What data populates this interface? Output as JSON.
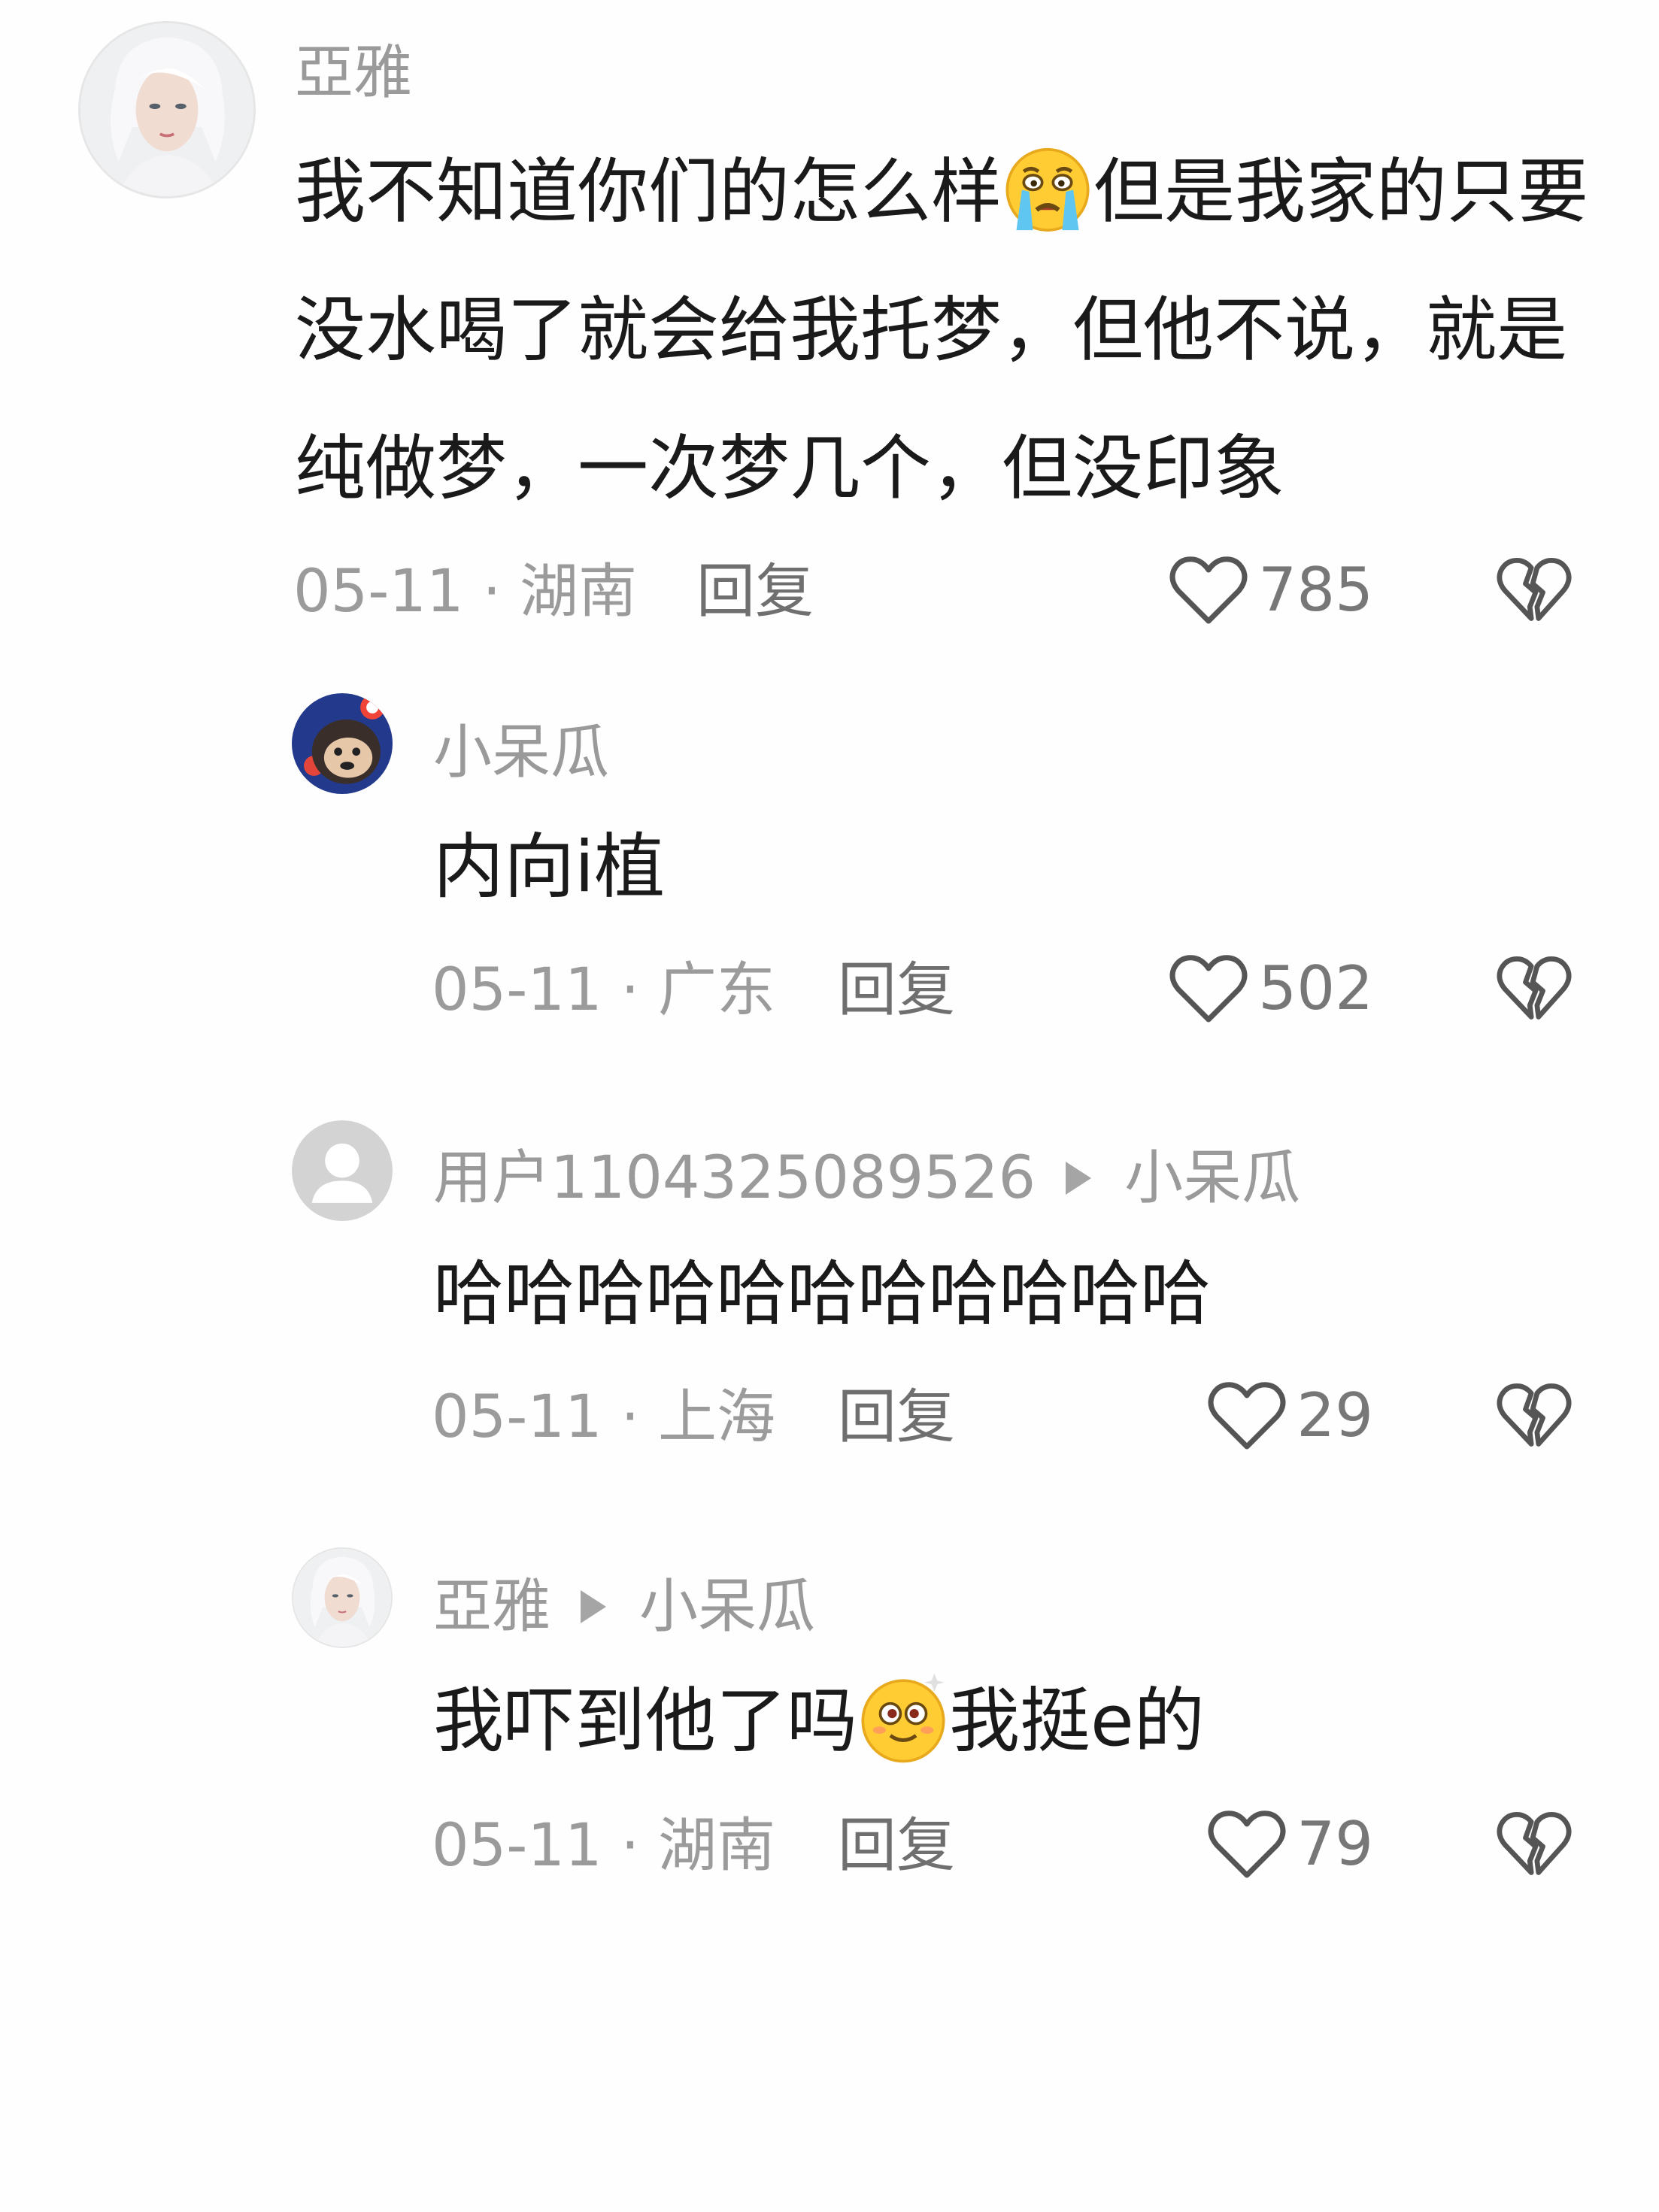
{
  "comments": [
    {
      "author": "亞雅",
      "text_before": "我不知道你们的怎么样",
      "emoji_icon": "crying-face-icon",
      "text_line1_after": "但是我家的只要",
      "text_line2": "没水喝了就会给我托梦，但他不说，就是",
      "text_line3": "纯做梦，一次梦几个，但没印象",
      "meta": "05-11 · 湖南",
      "reply": "回复",
      "likes": "785"
    }
  ],
  "replies": [
    {
      "author": "小呆瓜",
      "text": "内向i植",
      "meta": "05-11 · 广东",
      "reply": "回复",
      "likes": "502"
    },
    {
      "author": "用户1104325089526",
      "reply_to": "小呆瓜",
      "text": "哈哈哈哈哈哈哈哈哈哈哈",
      "meta": "05-11 · 上海",
      "reply": "回复",
      "likes": "29"
    },
    {
      "author": "亞雅",
      "reply_to": "小呆瓜",
      "text_before": "我吓到他了吗",
      "emoji_icon": "dizzy-face-icon",
      "text_after": "我挺e的",
      "meta": "05-11 · 湖南",
      "reply": "回复",
      "likes": "79"
    }
  ],
  "colors": {
    "background": "#fefefe",
    "name": "#9a9a9a",
    "body_text": "#1a1a1a",
    "meta": "#9b9b9b",
    "reply": "#6f6f6f"
  }
}
